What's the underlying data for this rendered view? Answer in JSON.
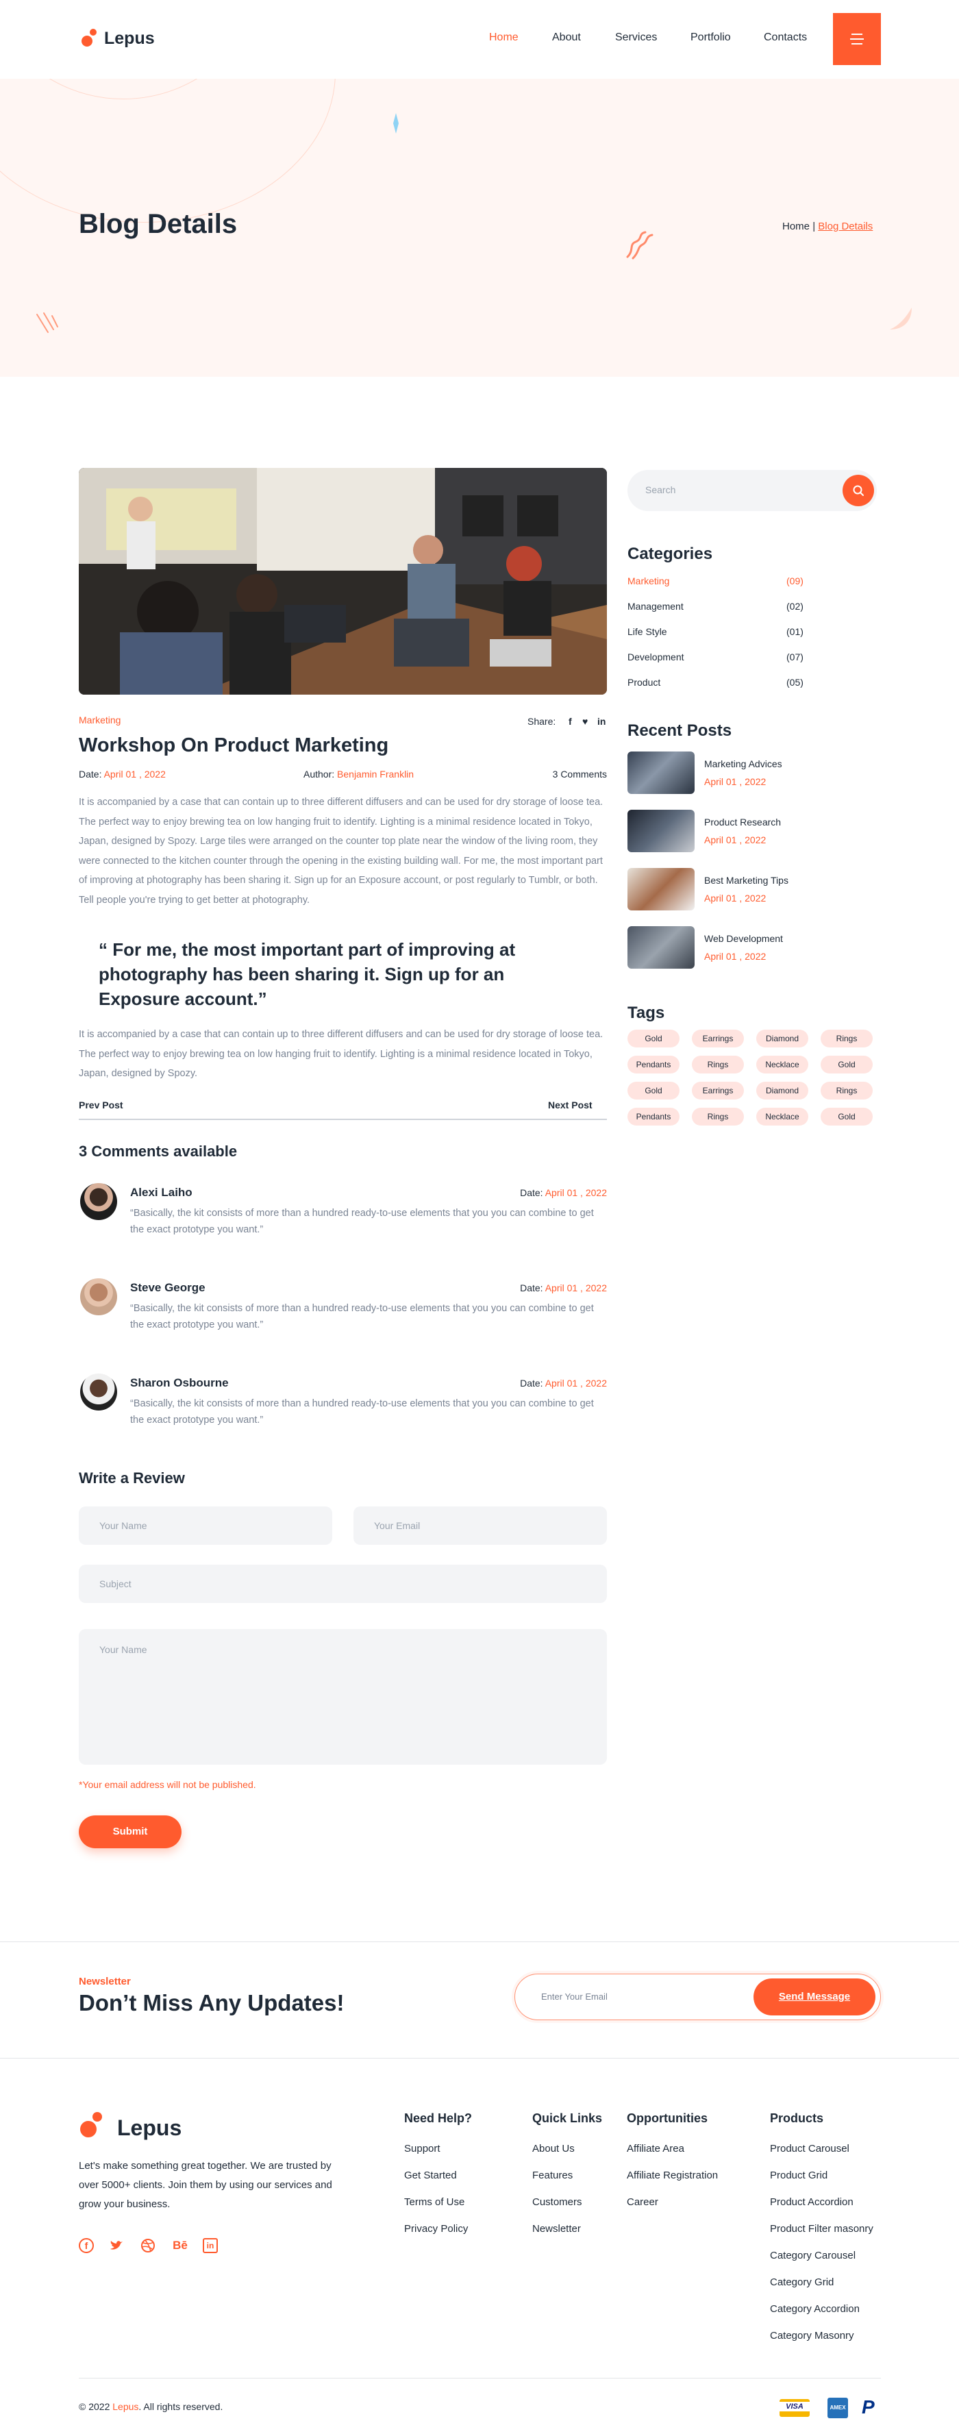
{
  "header": {
    "brand": "Lepus",
    "nav": [
      "Home",
      "About",
      "Services",
      "Portfolio",
      "Contacts"
    ],
    "menu_icon": "hamburger-icon"
  },
  "hero": {
    "title": "Blog Details",
    "breadcrumb_home": "Home",
    "breadcrumb_sep": "|",
    "breadcrumb_current": "Blog Details"
  },
  "post": {
    "category": "Marketing",
    "share_label": "Share:",
    "title": "Workshop On Product Marketing",
    "date_label": "Date:",
    "date": "April 01 , 2022",
    "author_label": "Author:",
    "author": "Benjamin Franklin",
    "comments_count": "3 Comments",
    "body1": "It is accompanied by a case that can contain up to three different diffusers and can be used for dry storage of loose tea. The perfect way to enjoy brewing tea on low hanging fruit to identify. Lighting is a minimal residence located in Tokyo, Japan, designed by Spozy. Large tiles were arranged on the counter top plate near the window of the living room, they were connected to the kitchen counter through the opening in the existing building wall. For me, the most important part of improving at photography has been sharing it. Sign up for an Exposure account, or post regularly to Tumblr, or both. Tell people you're trying to get better at photography.",
    "quote": "“ For me, the most important part of improving at photography has been sharing it. Sign up for an Exposure account.”",
    "body2": "It is accompanied by a case that can contain up to three different diffusers and can be used for dry storage of loose tea. The perfect way to enjoy brewing tea on low hanging fruit to identify. Lighting is a minimal residence located in Tokyo, Japan, designed by Spozy.",
    "prev": "Prev Post",
    "next": "Next Post"
  },
  "comments": {
    "heading": "3 Comments available",
    "items": [
      {
        "name": "Alexi Laiho",
        "date_label": "Date:",
        "date": "April 01 , 2022",
        "text": "“Basically, the kit consists of more than a hundred ready-to-use elements that you you can combine to get the exact prototype you want.”"
      },
      {
        "name": "Steve George",
        "date_label": "Date:",
        "date": "April 01 , 2022",
        "text": "“Basically, the kit consists of more than a hundred ready-to-use elements that you you can combine to get the exact prototype you want.”"
      },
      {
        "name": "Sharon Osbourne",
        "date_label": "Date:",
        "date": "April 01 , 2022",
        "text": "“Basically, the kit consists of more than a hundred ready-to-use elements that you you can combine to get the exact prototype you want.”"
      }
    ]
  },
  "review": {
    "heading": "Write a Review",
    "name_ph": "Your Name",
    "email_ph": "Your Email",
    "subject_ph": "Subject",
    "message_ph": "Your Name",
    "note": "*Your email address will not be published.",
    "submit": "Submit"
  },
  "sidebar": {
    "search_ph": "Search",
    "categories_title": "Categories",
    "categories": [
      {
        "name": "Marketing",
        "count": "(09)"
      },
      {
        "name": "Management",
        "count": "(02)"
      },
      {
        "name": "Life Style",
        "count": "(01)"
      },
      {
        "name": "Development",
        "count": "(07)"
      },
      {
        "name": "Product",
        "count": "(05)"
      }
    ],
    "recent_title": "Recent Posts",
    "recent": [
      {
        "title": "Marketing Advices",
        "date": "April 01 , 2022"
      },
      {
        "title": "Product Research",
        "date": "April 01 , 2022"
      },
      {
        "title": "Best Marketing Tips",
        "date": "April 01 , 2022"
      },
      {
        "title": "Web Development",
        "date": "April 01 , 2022"
      }
    ],
    "tags_title": "Tags",
    "tags": [
      "Gold",
      "Earrings",
      "Diamond",
      "Rings",
      "Pendants",
      "Rings",
      "Necklace",
      "Gold",
      "Gold",
      "Earrings",
      "Diamond",
      "Rings",
      "Pendants",
      "Rings",
      "Necklace",
      "Gold"
    ]
  },
  "newsletter": {
    "eyebrow": "Newsletter",
    "title": "Don’t Miss Any Updates!",
    "email_ph": "Enter Your Email",
    "button": "Send Message"
  },
  "footer": {
    "brand": "Lepus",
    "about": "Let's make something great together. We are trusted by over 5000+ clients. Join them by using our services and grow your business.",
    "social_icons": [
      "facebook-icon",
      "twitter-icon",
      "dribbble-icon",
      "behance-icon",
      "linkedin-icon"
    ],
    "cols": [
      {
        "title": "Need Help?",
        "links": [
          "Support",
          "Get Started",
          "Terms of Use",
          "Privacy Policy"
        ]
      },
      {
        "title": "Quick Links",
        "links": [
          "About Us",
          "Features",
          "Customers",
          "Newsletter"
        ]
      },
      {
        "title": "Opportunities",
        "links": [
          "Affiliate Area",
          "Affiliate Registration",
          "Career"
        ]
      },
      {
        "title": "Products",
        "links": [
          "Product Carousel",
          "Product Grid",
          "Product Accordion",
          "Product Filter masonry",
          "Category Carousel",
          "Category Grid",
          "Category Accordion",
          "Category Masonry"
        ]
      }
    ],
    "copyright_pre": "© 2022",
    "copyright_brand": "Lepus",
    "copyright_post": ". All rights reserved.",
    "payments": [
      "visa-icon",
      "amex-icon",
      "paypal-icon"
    ]
  },
  "colors": {
    "accent": "#ff5b2e",
    "hero_bg": "#fff6f3",
    "tag_bg": "#ffe4e0"
  }
}
